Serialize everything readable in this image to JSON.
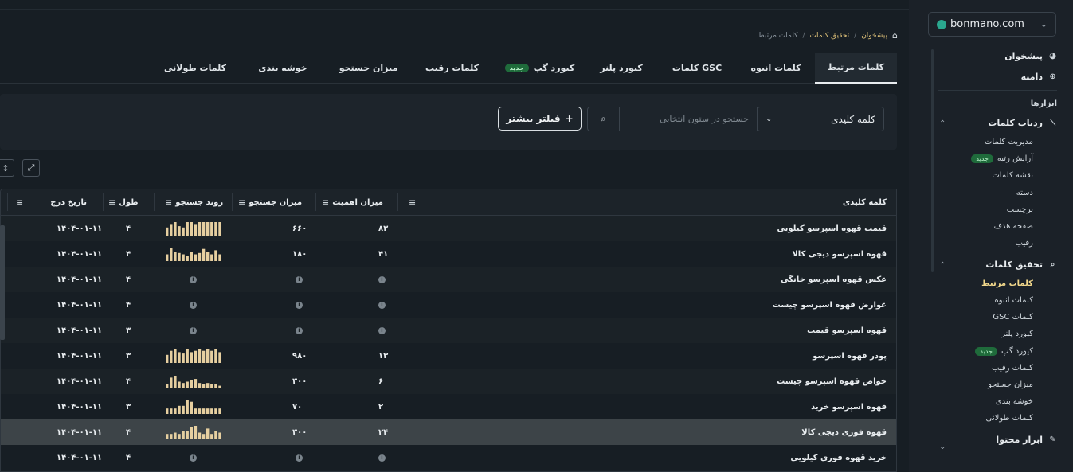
{
  "sidebar": {
    "domain": "bonmano.com",
    "nav_dashboard": "پیشخوان",
    "nav_domain": "دامنه",
    "section_tools": "ابزارها",
    "rank_tracker": {
      "label": "ردیاب کلمات",
      "items": [
        "مدیریت کلمات",
        "آرایش رتبه",
        "نقشه کلمات",
        "دسته",
        "برچسب",
        "صفحه هدف",
        "رقیب"
      ]
    },
    "keyword_research": {
      "label": "تحقیق کلمات",
      "items": [
        "کلمات مرتبط",
        "کلمات انبوه",
        "کلمات GSC",
        "کیورد پلنر",
        "کیورد گپ",
        "کلمات رقیب",
        "میزان جستجو",
        "خوشه بندی",
        "کلمات طولانی"
      ]
    },
    "content_tools": "ابزار محتوا",
    "new_badge": "جدید"
  },
  "breadcrumb": {
    "items": [
      "پیشخوان",
      "تحقیق کلمات",
      "کلمات مرتبط"
    ]
  },
  "tabs": [
    {
      "label": "کلمات مرتبط",
      "active": true
    },
    {
      "label": "کلمات انبوه"
    },
    {
      "label": "کلمات GSC"
    },
    {
      "label": "کیورد پلنر"
    },
    {
      "label": "کیورد گپ",
      "badge": "جدید"
    },
    {
      "label": "کلمات رقیب"
    },
    {
      "label": "میزان جستجو"
    },
    {
      "label": "خوشه بندی"
    },
    {
      "label": "کلمات طولانی"
    }
  ],
  "filter": {
    "column_select": "کلمه کلیدی",
    "search_placeholder": "جستجو در ستون انتخابی",
    "more_filters": "فیلتر بیشتر"
  },
  "table": {
    "headers": {
      "keyword": "کلمه کلیدی",
      "importance": "میزان اهمیت",
      "volume": "میزان جستجو",
      "trend": "روند جستجو",
      "length": "طول",
      "date": "تاریخ درج"
    },
    "rows": [
      {
        "keyword": "قیمت قهوه اسپرسو کیلویی",
        "importance": "۸۳",
        "volume": "۶۶۰",
        "trend": [
          0.6,
          0.8,
          1,
          0.7,
          0.6,
          1,
          1,
          0.8,
          1,
          1,
          1,
          1,
          1,
          1
        ],
        "length": "۴",
        "date": "۱۴۰۴-۰۱-۱۱"
      },
      {
        "keyword": "قهوه اسپرسو دیجی کالا",
        "importance": "۴۱",
        "volume": "۱۸۰",
        "trend": [
          0.5,
          1,
          0.7,
          0.6,
          0.5,
          0.4,
          0.7,
          0.5,
          0.6,
          0.9,
          0.7,
          0.5,
          0.8,
          0.5
        ],
        "length": "۴",
        "date": "۱۴۰۴-۰۱-۱۱"
      },
      {
        "keyword": "عکس قهوه اسپرسو خانگی",
        "importance": null,
        "volume": null,
        "trend": null,
        "length": "۴",
        "date": "۱۴۰۴-۰۱-۱۱"
      },
      {
        "keyword": "عوارض قهوه اسپرسو چیست",
        "importance": null,
        "volume": null,
        "trend": null,
        "length": "۴",
        "date": "۱۴۰۴-۰۱-۱۱"
      },
      {
        "keyword": "قهوه اسپرسو قیمت",
        "importance": null,
        "volume": null,
        "trend": null,
        "length": "۳",
        "date": "۱۴۰۴-۰۱-۱۱"
      },
      {
        "keyword": "پودر قهوه اسپرسو",
        "importance": "۱۳",
        "volume": "۹۸۰",
        "trend": [
          0.6,
          0.9,
          1,
          0.8,
          0.7,
          1,
          0.8,
          0.9,
          1,
          0.9,
          1,
          0.9,
          1,
          0.8
        ],
        "length": "۳",
        "date": "۱۴۰۴-۰۱-۱۱"
      },
      {
        "keyword": "خواص قهوه اسپرسو چیست",
        "importance": "۶",
        "volume": "۳۰۰",
        "trend": [
          0.3,
          0.8,
          0.9,
          0.5,
          0.4,
          0.5,
          0.6,
          0.7,
          0.4,
          0.3,
          0.4,
          0.3,
          0.3,
          0.2
        ],
        "length": "۴",
        "date": "۱۴۰۴-۰۱-۱۱"
      },
      {
        "keyword": "قهوه اسپرسو خرید",
        "importance": "۲",
        "volume": "۷۰",
        "trend": [
          0.4,
          0.4,
          0.4,
          0.6,
          0.6,
          1,
          0.9,
          0.4,
          0.4,
          0.4,
          0.4,
          0.4,
          0.4,
          0.4
        ],
        "length": "۳",
        "date": "۱۴۰۴-۰۱-۱۱"
      },
      {
        "keyword": "قهوه فوری دیجی کالا",
        "importance": "۲۴",
        "volume": "۳۰۰",
        "trend": [
          0.4,
          0.4,
          0.5,
          0.4,
          0.6,
          0.6,
          0.9,
          1,
          0.5,
          0.4,
          0.8,
          0.4,
          0.6,
          0.5
        ],
        "length": "۴",
        "date": "۱۴۰۴-۰۱-۱۱",
        "highlight": true
      },
      {
        "keyword": "خرید قهوه فوری کیلویی",
        "importance": null,
        "volume": null,
        "trend": null,
        "length": "۴",
        "date": "۱۴۰۴-۰۱-۱۱"
      }
    ]
  },
  "colors": {
    "accent": "#f1d78b",
    "trend_bar": "#e6cfa0",
    "new_badge": "#1f6b3b"
  },
  "icons": {
    "home": "home-icon",
    "info": "info-icon",
    "expand": "expand-icon",
    "sort": "sort-icon"
  }
}
